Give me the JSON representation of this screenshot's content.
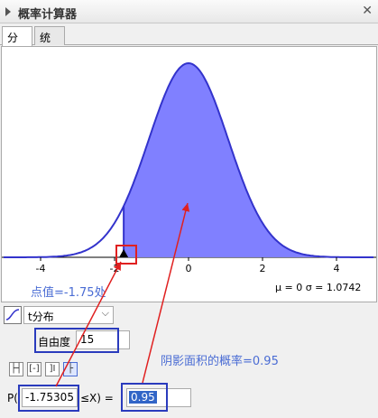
{
  "window": {
    "title": "概率计算器",
    "close": "✕"
  },
  "tabs": [
    {
      "label": "分布"
    },
    {
      "label": "统计"
    }
  ],
  "plot": {
    "x_ticks": [
      "-4",
      "-2",
      "0",
      "2",
      "4"
    ],
    "params_text": "μ = 0   σ = 1.0742",
    "shade_from": -1.75305,
    "curve_color": "#3333cc",
    "fill_color": "#8080ff"
  },
  "annotations": {
    "point_label": "点值=-1.75处",
    "area_label": "阴影面积的概率=0.95"
  },
  "distribution": {
    "selected": "t分布"
  },
  "df": {
    "label": "自由度",
    "value": "15"
  },
  "mode_buttons": [
    "├┤",
    "[-]",
    "]I",
    "├"
  ],
  "probability": {
    "p_prefix": "P(",
    "lower": "-1.75305",
    "operator": "≤X)  =",
    "result": "0.95"
  }
}
